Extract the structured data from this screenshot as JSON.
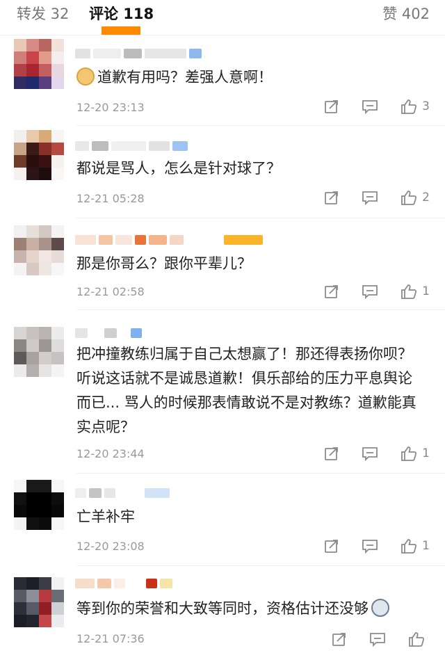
{
  "tabs": {
    "repost_label": "转发 32",
    "comments_label": "评论 118",
    "likes_label": "赞 402"
  },
  "comments": [
    {
      "text": "道歉有用吗？差强人意啊！",
      "time": "12-20 23:13",
      "likes": "3"
    },
    {
      "text": "都说是骂人，怎么是针对球了？",
      "time": "12-21 05:28",
      "likes": "2"
    },
    {
      "text": "那是你哥么？跟你平辈儿？",
      "time": "12-21 02:58",
      "likes": "1"
    },
    {
      "text": "把冲撞教练归属于自己太想赢了！那还得表扬你呗？听说这话就不是诚恳道歉！俱乐部给的压力平息舆论而已... 骂人的时候那表情敢说不是对教练？道歉能真实点呢？",
      "time": "12-20 23:44",
      "likes": "1"
    },
    {
      "text": "亡羊补牢",
      "time": "12-20 23:08",
      "likes": "1"
    },
    {
      "text": "等到你的荣誉和大致等同时，资格估计还没够",
      "time": "12-21 07:36",
      "likes": ""
    }
  ],
  "icons": {
    "repost": "share-square-icon",
    "reply": "comment-bubble-icon",
    "like": "thumbs-up-icon",
    "emoji_doge": "doge-emoji-icon",
    "emoji_husky": "husky-emoji-icon"
  },
  "colors": {
    "accent": "#ff8a00",
    "muted_text": "#999999",
    "body_text": "#222222"
  }
}
